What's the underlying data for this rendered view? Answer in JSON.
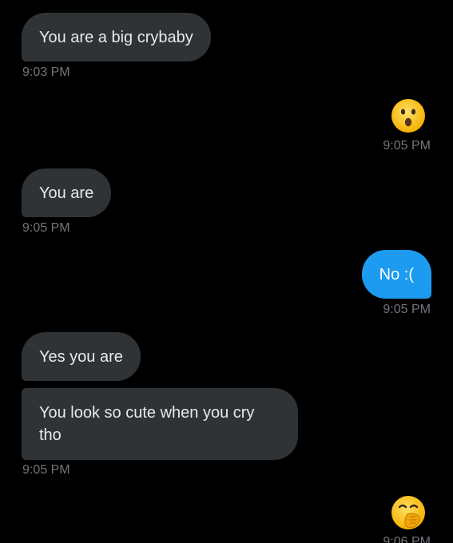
{
  "messages": [
    {
      "text": "You are a big crybaby",
      "time": "9:03 PM"
    },
    {
      "emoji": "hushed-face",
      "time": "9:05 PM"
    },
    {
      "text": "You are",
      "time": "9:05 PM"
    },
    {
      "text": "No :(",
      "time": "9:05 PM"
    },
    {
      "text": "Yes you are"
    },
    {
      "text": "You look so cute when you cry tho",
      "time": "9:05 PM"
    },
    {
      "emoji": "face-with-hand-over-mouth",
      "time": "9:06 PM"
    }
  ],
  "colors": {
    "background": "#000000",
    "received_bubble": "#2f3336",
    "sent_bubble": "#1d9bf0",
    "timestamp": "#71767b"
  }
}
